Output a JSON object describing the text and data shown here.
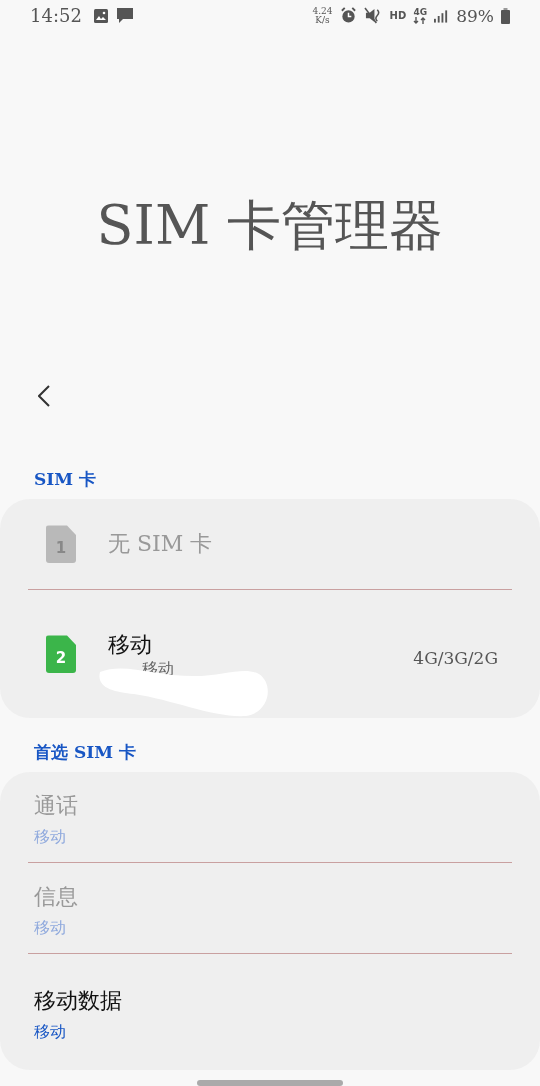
{
  "status_bar": {
    "time": "14:52",
    "speed_value": "4.24",
    "speed_unit": "K/s",
    "hd": "HD",
    "network": "4G",
    "battery": "89%"
  },
  "title": "SIM 卡管理器",
  "sections": [
    {
      "header": "SIM 卡",
      "kind": "sims",
      "items": [
        {
          "number": "1",
          "name": "无 SIM 卡",
          "disabled": true
        },
        {
          "number": "2",
          "name": "移动",
          "subtitle": "移动",
          "network_mode": "4G/3G/2G",
          "disabled": false,
          "redacted": true
        }
      ]
    },
    {
      "header": "首选 SIM 卡",
      "kind": "prefs",
      "items": [
        {
          "name": "通话",
          "value": "移动",
          "disabled": true
        },
        {
          "name": "信息",
          "value": "移动",
          "disabled": true
        },
        {
          "name": "移动数据",
          "value": "移动",
          "disabled": false
        }
      ]
    }
  ]
}
